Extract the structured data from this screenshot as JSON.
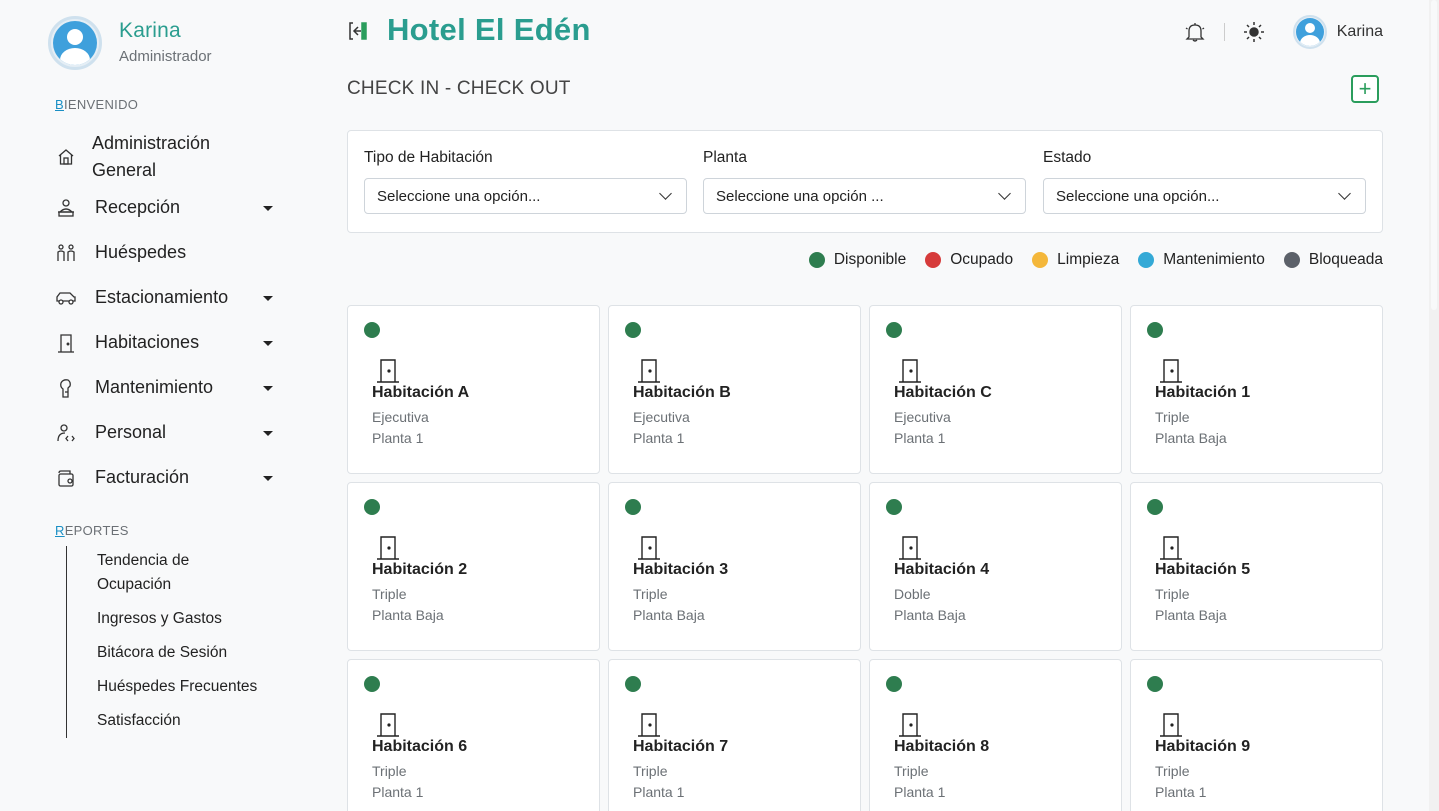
{
  "user": {
    "name": "Karina",
    "role": "Administrador"
  },
  "sidebar": {
    "welcome_first": "B",
    "welcome_rest": "IENVENIDO",
    "items": [
      {
        "label": "Administración General",
        "icon": "home-icon",
        "dropdown": false
      },
      {
        "label": "Recepción",
        "icon": "reception-icon",
        "dropdown": true
      },
      {
        "label": "Huéspedes",
        "icon": "guests-icon",
        "dropdown": false
      },
      {
        "label": "Estacionamiento",
        "icon": "car-icon",
        "dropdown": true
      },
      {
        "label": "Habitaciones",
        "icon": "door-icon",
        "dropdown": true
      },
      {
        "label": "Mantenimiento",
        "icon": "wrench-icon",
        "dropdown": true
      },
      {
        "label": "Personal",
        "icon": "person-code-icon",
        "dropdown": true
      },
      {
        "label": "Facturación",
        "icon": "wallet-icon",
        "dropdown": true
      }
    ],
    "reports_first": "R",
    "reports_rest": "EPORTES",
    "reports": [
      "Tendencia de Ocupación",
      "Ingresos y Gastos",
      "Bitácora de Sesión",
      "Huéspedes Frecuentes",
      "Satisfacción"
    ]
  },
  "header": {
    "brand": "Hotel El Edén",
    "user_name": "Karina",
    "icons": [
      "logout-icon",
      "bell-icon",
      "sun-icon"
    ]
  },
  "page": {
    "title": "CHECK IN - CHECK OUT",
    "add_button": "+"
  },
  "filters": [
    {
      "label": "Tipo de Habitación",
      "value": "Seleccione una opción..."
    },
    {
      "label": "Planta",
      "value": "Seleccione una opción ..."
    },
    {
      "label": "Estado",
      "value": "Seleccione una opción..."
    }
  ],
  "legend": [
    {
      "label": "Disponible",
      "color": "#2e7d4f"
    },
    {
      "label": "Ocupado",
      "color": "#d63b3b"
    },
    {
      "label": "Limpieza",
      "color": "#f4b73a"
    },
    {
      "label": "Mantenimiento",
      "color": "#34a9d6"
    },
    {
      "label": "Bloqueada",
      "color": "#5c6169"
    }
  ],
  "rooms": [
    {
      "name": "Habitación A",
      "type": "Ejecutiva",
      "floor": "Planta 1",
      "status_color": "#2e7d4f"
    },
    {
      "name": "Habitación B",
      "type": "Ejecutiva",
      "floor": "Planta 1",
      "status_color": "#2e7d4f"
    },
    {
      "name": "Habitación C",
      "type": "Ejecutiva",
      "floor": "Planta 1",
      "status_color": "#2e7d4f"
    },
    {
      "name": "Habitación 1",
      "type": "Triple",
      "floor": "Planta Baja",
      "status_color": "#2e7d4f"
    },
    {
      "name": "Habitación 2",
      "type": "Triple",
      "floor": "Planta Baja",
      "status_color": "#2e7d4f"
    },
    {
      "name": "Habitación 3",
      "type": "Triple",
      "floor": "Planta Baja",
      "status_color": "#2e7d4f"
    },
    {
      "name": "Habitación 4",
      "type": "Doble",
      "floor": "Planta Baja",
      "status_color": "#2e7d4f"
    },
    {
      "name": "Habitación 5",
      "type": "Triple",
      "floor": "Planta Baja",
      "status_color": "#2e7d4f"
    },
    {
      "name": "Habitación 6",
      "type": "Triple",
      "floor": "Planta 1",
      "status_color": "#2e7d4f"
    },
    {
      "name": "Habitación 7",
      "type": "Triple",
      "floor": "Planta 1",
      "status_color": "#2e7d4f"
    },
    {
      "name": "Habitación 8",
      "type": "Triple",
      "floor": "Planta 1",
      "status_color": "#2e7d4f"
    },
    {
      "name": "Habitación 9",
      "type": "Triple",
      "floor": "Planta 1",
      "status_color": "#2e7d4f"
    }
  ],
  "colors": {
    "brand": "#2a9d8f",
    "accent_link": "#1a8fc4",
    "add_button": "#2a9d5c"
  }
}
